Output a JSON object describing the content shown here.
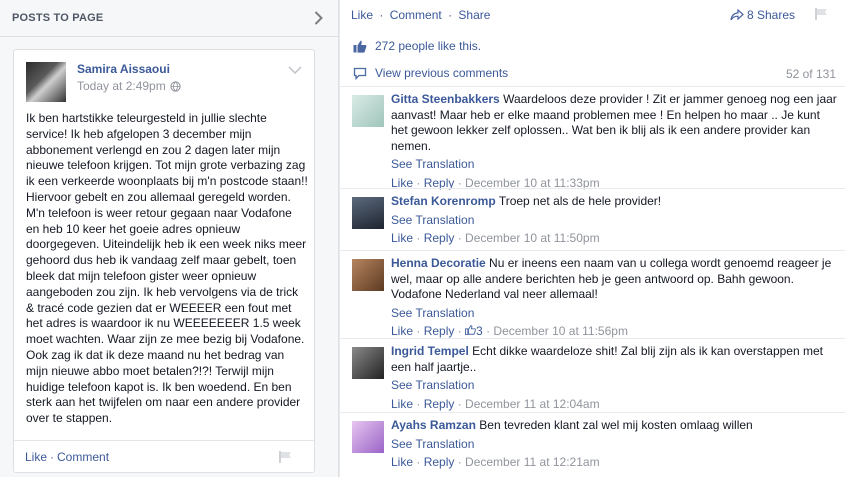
{
  "left": {
    "header_title": "POSTS TO PAGE",
    "post": {
      "author": "Samira Aissaoui",
      "timestamp": "Today at 2:49pm",
      "body": "Ik ben hartstikke teleurgesteld in jullie slechte service! Ik heb afgelopen 3 december mijn abbonement verlengd en zou 2 dagen later mijn nieuwe telefoon krijgen. Tot mijn grote verbazing zag ik een verkeerde woonplaats bij m'n postcode staan!! Hiervoor gebelt en zou allemaal geregeld worden. M'n telefoon is weer retour gegaan naar Vodafone en heb 10 keer het goeie adres opnieuw doorgegeven. Uiteindelijk heb ik een week niks meer gehoord dus heb ik vandaag zelf maar gebelt, toen bleek dat mijn telefoon gister weer opnieuw aangeboden zou zijn. Ik heb vervolgens via de trick & tracé code gezien dat er WEEEER een fout met het adres is waardoor ik nu WEEEEEEER 1.5 week moet wachten. Waar zijn ze mee bezig bij Vodafone. Ook zag ik dat ik deze maand nu het bedrag van mijn nieuwe abbo moet betalen?!?! Terwijl mijn huidige telefoon kapot is. Ik ben woedend. En ben sterk aan het twijfelen om naar een andere provider over te stappen.",
      "like_label": "Like",
      "comment_label": "Comment",
      "separator": "·"
    }
  },
  "right": {
    "like_label": "Like",
    "comment_label": "Comment",
    "share_label": "Share",
    "separator": "·",
    "shares_label": "8 Shares",
    "likes_text": "272 people like this.",
    "view_previous": "View previous comments",
    "pager": "52 of 131",
    "comments": [
      {
        "name": "Gitta Steenbakkers",
        "text": "Waardeloos deze provider ! Zit er jammer genoeg nog een jaar aanvast! Maar heb er elke maand problemen mee ! En helpen ho maar .. Je kunt het gewoon lekker zelf oplossen.. Wat ben ik blij als ik een andere provider kan nemen.",
        "see_translation": "See Translation",
        "like": "Like",
        "reply": "Reply",
        "time": "December 10 at 11:33pm",
        "reactions": "",
        "avatar_color": "#bcd7d0"
      },
      {
        "name": "Stefan Korenromp",
        "text": "Troep net als de hele provider!",
        "see_translation": "See Translation",
        "like": "Like",
        "reply": "Reply",
        "time": "December 10 at 11:50pm",
        "reactions": "",
        "avatar_color": "#2f3a4a"
      },
      {
        "name": "Henna Decoratie",
        "text": "Nu er ineens een naam van u collega wordt genoemd reageer je wel, maar op alle andere berichten heb je geen antwoord op. Bahh gewoon. Vodafone Nederland val neer allemaal!",
        "see_translation": "See Translation",
        "like": "Like",
        "reply": "Reply",
        "time": "December 10 at 11:56pm",
        "reactions": "3",
        "avatar_color": "#8a5a3c"
      },
      {
        "name": "Ingrid Tempel",
        "text": "Echt dikke waardeloze shit! Zal blij zijn als ik kan overstappen met een half jaartje..",
        "see_translation": "See Translation",
        "like": "Like",
        "reply": "Reply",
        "time": "December 11 at 12:04am",
        "reactions": "",
        "avatar_color": "#3b3b3b"
      },
      {
        "name": "Ayahs Ramzan",
        "text": "Ben tevreden klant zal wel mij kosten omlaag willen",
        "see_translation": "See Translation",
        "like": "Like",
        "reply": "Reply",
        "time": "December 11 at 12:21am",
        "reactions": "",
        "avatar_color": "#c79ad9"
      }
    ]
  }
}
